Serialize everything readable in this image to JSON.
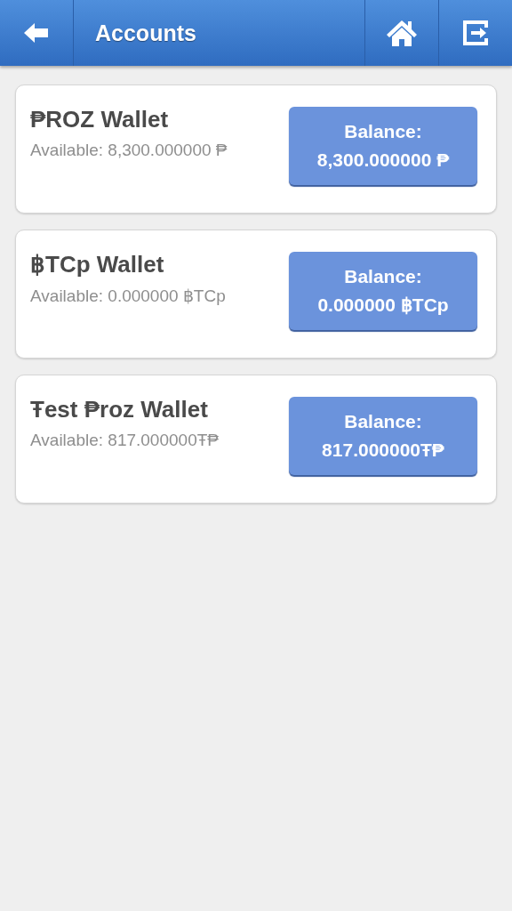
{
  "header": {
    "title": "Accounts"
  },
  "wallets": [
    {
      "name": "₱ROZ Wallet",
      "available": "Available: 8,300.000000 ₱",
      "balance_label": "Balance:",
      "balance": "8,300.000000 ₱"
    },
    {
      "name": "฿TCp Wallet",
      "available": "Available: 0.000000 ฿TCp",
      "balance_label": "Balance:",
      "balance": "0.000000 ฿TCp"
    },
    {
      "name": "Ŧest ₱roz Wallet",
      "available": "Available: 817.000000Ŧ₱",
      "balance_label": "Balance:",
      "balance": "817.000000Ŧ₱"
    }
  ]
}
